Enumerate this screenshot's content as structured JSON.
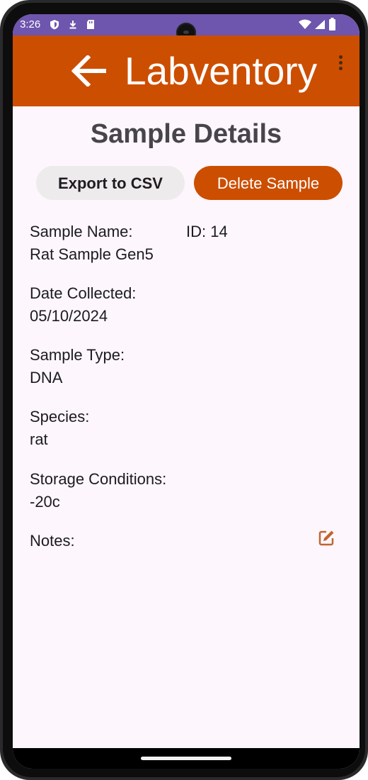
{
  "status_bar": {
    "time": "3:26",
    "color": "#6e55ad"
  },
  "app_bar": {
    "title": "Labventory",
    "color": "#cc4e00",
    "back_icon": "arrow-left-icon",
    "menu_icon": "more-vert-icon"
  },
  "page": {
    "title": "Sample Details"
  },
  "actions": {
    "export_label": "Export to CSV",
    "delete_label": "Delete Sample"
  },
  "sample": {
    "name_label": "Sample Name:",
    "name_value": "Rat Sample Gen5",
    "id_text": "ID: 14",
    "date_label": "Date Collected:",
    "date_value": "05/10/2024",
    "type_label": "Sample Type:",
    "type_value": "DNA",
    "species_label": "Species:",
    "species_value": "rat",
    "storage_label": "Storage Conditions:",
    "storage_value": "-20c",
    "notes_label": "Notes:",
    "edit_icon": "edit-icon"
  }
}
